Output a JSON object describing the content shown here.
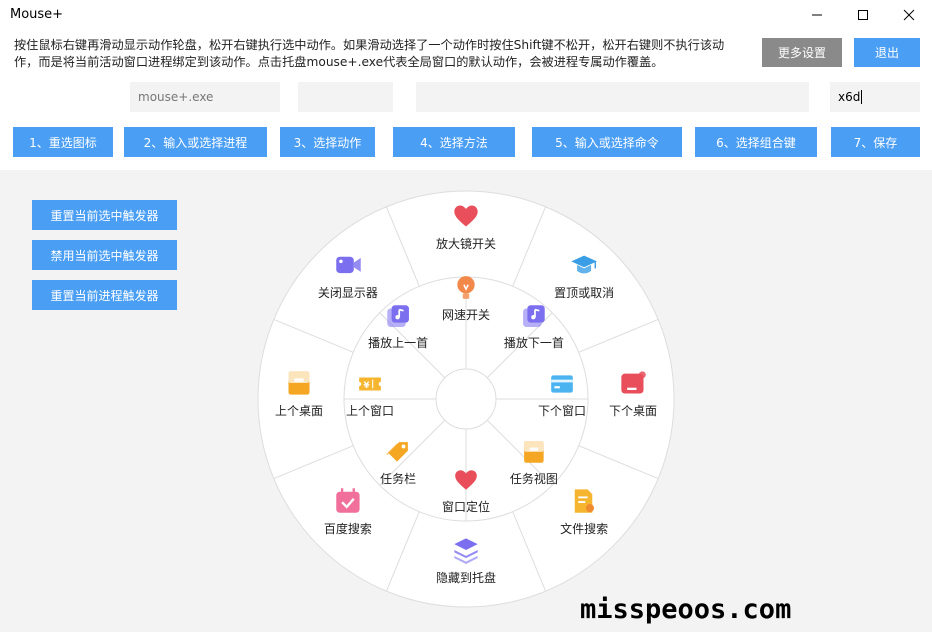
{
  "window": {
    "title": "Mouse+",
    "controls": [
      "minimize",
      "maximize",
      "close"
    ]
  },
  "description": "按住鼠标右键再滑动显示动作轮盘，松开右键执行选中动作。如果滑动选择了一个动作时按住Shift键不松开，松开右键则不执行该动作，而是将当前活动窗口进程绑定到该动作。点击托盘mouse+.exe代表全局窗口的默认动作，会被进程专属动作覆盖。",
  "top_buttons": {
    "more_settings": "更多设置",
    "exit": "退出"
  },
  "fields": {
    "process": "mouse+.exe",
    "action": "",
    "command": "",
    "hotkey": "x6d"
  },
  "steps": [
    "1、重选图标",
    "2、输入或选择进程",
    "3、选择动作",
    "4、选择方法",
    "5、输入或选择命令",
    "6、选择组合键",
    "7、保存"
  ],
  "triggers": [
    "重置当前选中触发器",
    "禁用当前选中触发器",
    "重置当前进程触发器"
  ],
  "wheel": {
    "outer": [
      {
        "label": "放大镜开关",
        "icon": "heart-icon",
        "color": "#e84f5b"
      },
      {
        "label": "置顶或取消",
        "icon": "graduation-cap-icon",
        "color": "#3a9ee6"
      },
      {
        "label": "下个桌面",
        "icon": "card-icon",
        "color": "#e84f5b"
      },
      {
        "label": "文件搜索",
        "icon": "document-search-icon",
        "color": "#f5b52e"
      },
      {
        "label": "隐藏到托盘",
        "icon": "layers-icon",
        "color": "#7b6ff0"
      },
      {
        "label": "百度搜索",
        "icon": "calendar-icon",
        "color": "#f0709b"
      },
      {
        "label": "上个桌面",
        "icon": "folder-icon",
        "color": "#f5a623"
      },
      {
        "label": "关闭显示器",
        "icon": "video-camera-icon",
        "color": "#7b6ff0"
      }
    ],
    "inner": [
      {
        "label": "网速开关",
        "icon": "lightbulb-icon",
        "color": "#f2894a"
      },
      {
        "label": "播放下一首",
        "icon": "music-note-icon",
        "color": "#7b6ff0"
      },
      {
        "label": "下个窗口",
        "icon": "window-card-icon",
        "color": "#4bb4f0"
      },
      {
        "label": "任务视图",
        "icon": "folder-icon",
        "color": "#f5a623"
      },
      {
        "label": "窗口定位",
        "icon": "heart-icon",
        "color": "#e84f5b"
      },
      {
        "label": "任务栏",
        "icon": "tag-icon",
        "color": "#f5a623"
      },
      {
        "label": "上个窗口",
        "icon": "ticket-icon",
        "color": "#f5b52e"
      },
      {
        "label": "播放上一首",
        "icon": "music-note-icon",
        "color": "#7b6ff0"
      }
    ]
  },
  "watermark": "misspeoos.com",
  "colors": {
    "accent": "#4a9ef4",
    "secondary": "#8a8a8a",
    "panel_bg": "#f3f3f3"
  }
}
